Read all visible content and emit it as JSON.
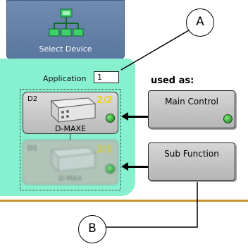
{
  "select_device": {
    "label": "Select Device"
  },
  "application": {
    "label": "Application",
    "value": "1"
  },
  "devices": [
    {
      "id": "D2",
      "count": "2/2",
      "name": "D-MAXE"
    },
    {
      "id": "D1",
      "count": "2/1",
      "name": "D-MAX"
    }
  ],
  "used_as": {
    "label": "used as:"
  },
  "functions": [
    {
      "label": "Main Control"
    },
    {
      "label": "Sub Function"
    }
  ],
  "callouts": [
    "A",
    "B"
  ],
  "colors": {
    "highlight": "#86f0cf",
    "tab": "#5a779f",
    "led": "#22a322",
    "count": "#f0d21a",
    "divider": "#c8922c"
  }
}
